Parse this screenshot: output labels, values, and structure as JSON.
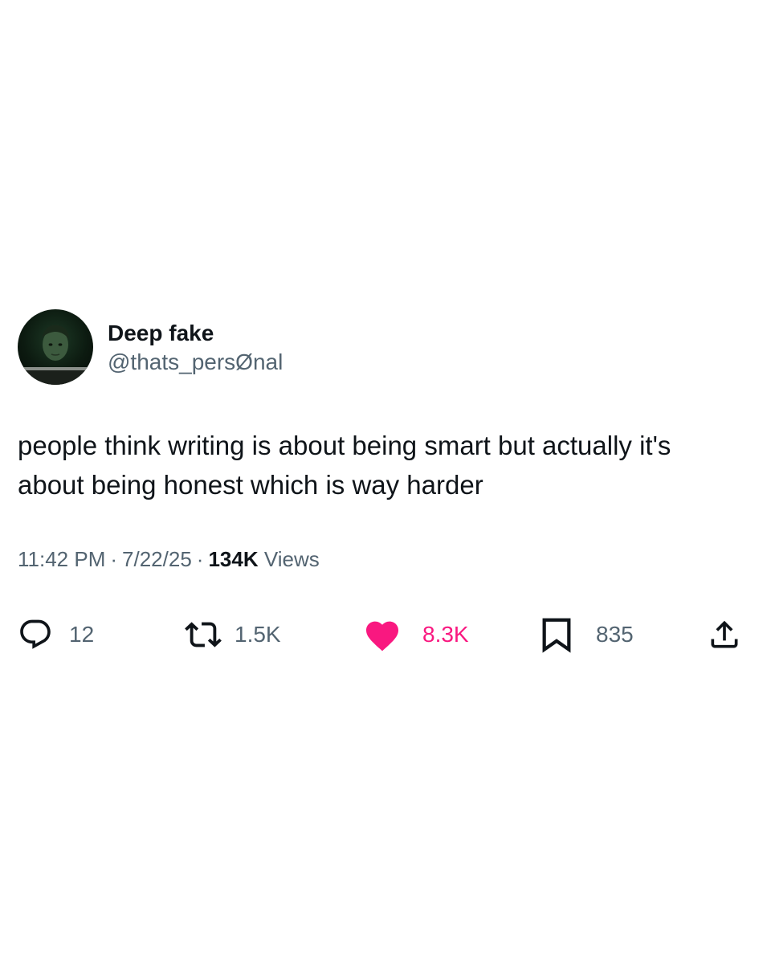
{
  "user": {
    "display_name": "Deep fake",
    "handle": "@thats_persØnal",
    "avatar_icon": "user-avatar"
  },
  "tweet": {
    "text": "people think writing is about being smart but actually it's about being honest which is way harder",
    "time": "11:42 PM",
    "date": "7/22/25",
    "views_count": "134K",
    "views_label": "Views",
    "separator": "·"
  },
  "actions": {
    "reply": {
      "icon": "reply-icon",
      "count": "12"
    },
    "retweet": {
      "icon": "retweet-icon",
      "count": "1.5K"
    },
    "like": {
      "icon": "heart-icon",
      "count": "8.3K",
      "liked": true
    },
    "bookmark": {
      "icon": "bookmark-icon",
      "count": "835"
    },
    "share": {
      "icon": "share-icon"
    }
  },
  "colors": {
    "text_primary": "#0f1419",
    "text_secondary": "#536471",
    "like_active": "#f91880"
  }
}
